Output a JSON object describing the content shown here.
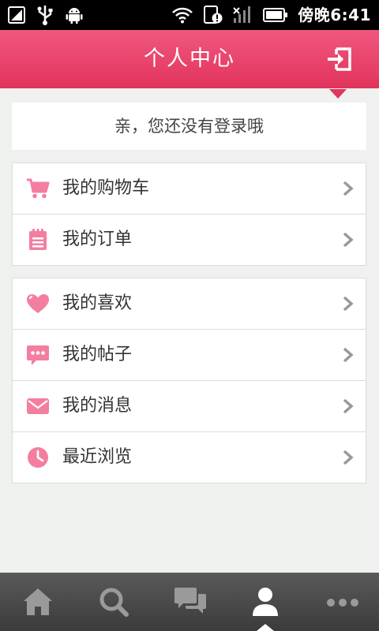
{
  "status_bar": {
    "time": "傍晚6:41",
    "icons": [
      "sim-icon",
      "usb-icon",
      "android-debug-icon",
      "wifi-icon",
      "notification-icon",
      "signal-icon",
      "battery-icon"
    ]
  },
  "header": {
    "title": "个人中心",
    "login_icon": "login-icon"
  },
  "login_prompt": {
    "text": "亲，您还没有登录哦"
  },
  "menu_groups": [
    {
      "items": [
        {
          "label": "我的购物车",
          "icon": "cart-icon"
        },
        {
          "label": "我的订单",
          "icon": "order-icon"
        }
      ]
    },
    {
      "items": [
        {
          "label": "我的喜欢",
          "icon": "heart-icon"
        },
        {
          "label": "我的帖子",
          "icon": "chat-bubble-icon"
        },
        {
          "label": "我的消息",
          "icon": "envelope-icon"
        },
        {
          "label": "最近浏览",
          "icon": "clock-icon"
        }
      ]
    }
  ],
  "tab_bar": {
    "tabs": [
      {
        "icon": "home-icon",
        "active": false
      },
      {
        "icon": "search-icon",
        "active": false
      },
      {
        "icon": "community-chat-icon",
        "active": false
      },
      {
        "icon": "user-icon",
        "active": true
      },
      {
        "icon": "more-icon",
        "active": false
      }
    ]
  },
  "colors": {
    "accent": "#e2345d",
    "icon_pink": "#f47ea0",
    "background": "#eef1ee",
    "tabbar": "#444444"
  }
}
